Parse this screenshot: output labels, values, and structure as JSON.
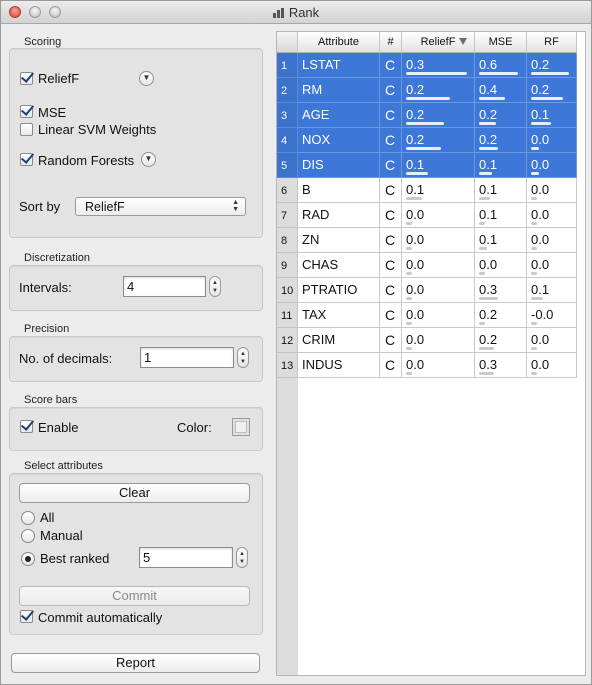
{
  "window": {
    "title": "Rank"
  },
  "scoring": {
    "group_label": "Scoring",
    "methods": [
      {
        "label": "ReliefF",
        "checked": true
      },
      {
        "label": "MSE",
        "checked": true
      },
      {
        "label": "Linear SVM Weights",
        "checked": false
      },
      {
        "label": "Random Forests",
        "checked": true
      }
    ],
    "sort_by_label": "Sort by",
    "sort_by_value": "ReliefF"
  },
  "discretization": {
    "group_label": "Discretization",
    "intervals_label": "Intervals:",
    "intervals_value": "4"
  },
  "precision": {
    "group_label": "Precision",
    "decimals_label": "No. of decimals:",
    "decimals_value": "1"
  },
  "score_bars": {
    "group_label": "Score bars",
    "enable_label": "Enable",
    "enable_checked": true,
    "color_label": "Color:"
  },
  "select_attributes": {
    "group_label": "Select attributes",
    "clear_label": "Clear",
    "options": [
      {
        "label": "All",
        "selected": false
      },
      {
        "label": "Manual",
        "selected": false
      },
      {
        "label": "Best ranked",
        "selected": true
      }
    ],
    "best_ranked_value": "5",
    "commit_label": "Commit",
    "commit_auto_label": "Commit automatically",
    "commit_auto_checked": true
  },
  "report_label": "Report",
  "table": {
    "columns": [
      "Attribute",
      "#",
      "ReliefF",
      "MSE",
      "RF"
    ],
    "sorted_column": "ReliefF",
    "rows": [
      {
        "num": "1",
        "attr": "LSTAT",
        "type": "C",
        "relieff": "0.3",
        "mse": "0.6",
        "rf": "0.2",
        "bars": [
          0.97,
          0.92,
          0.95
        ],
        "selected": true
      },
      {
        "num": "2",
        "attr": "RM",
        "type": "C",
        "relieff": "0.2",
        "mse": "0.4",
        "rf": "0.2",
        "bars": [
          0.7,
          0.62,
          0.8
        ],
        "selected": true
      },
      {
        "num": "3",
        "attr": "AGE",
        "type": "C",
        "relieff": "0.2",
        "mse": "0.2",
        "rf": "0.1",
        "bars": [
          0.6,
          0.4,
          0.5
        ],
        "selected": true
      },
      {
        "num": "4",
        "attr": "NOX",
        "type": "C",
        "relieff": "0.2",
        "mse": "0.2",
        "rf": "0.0",
        "bars": [
          0.55,
          0.45,
          0.2
        ],
        "selected": true
      },
      {
        "num": "5",
        "attr": "DIS",
        "type": "C",
        "relieff": "0.1",
        "mse": "0.1",
        "rf": "0.0",
        "bars": [
          0.35,
          0.3,
          0.2
        ],
        "selected": true
      },
      {
        "num": "6",
        "attr": "B",
        "type": "C",
        "relieff": "0.1",
        "mse": "0.1",
        "rf": "0.0",
        "bars": [
          0.25,
          0.25,
          0.0
        ],
        "selected": false
      },
      {
        "num": "7",
        "attr": "RAD",
        "type": "C",
        "relieff": "0.0",
        "mse": "0.1",
        "rf": "0.0",
        "bars": [
          0.0,
          0.0,
          0.0
        ],
        "selected": false
      },
      {
        "num": "8",
        "attr": "ZN",
        "type": "C",
        "relieff": "0.0",
        "mse": "0.1",
        "rf": "0.0",
        "bars": [
          0.0,
          0.2,
          0.0
        ],
        "selected": false
      },
      {
        "num": "9",
        "attr": "CHAS",
        "type": "C",
        "relieff": "0.0",
        "mse": "0.0",
        "rf": "0.0",
        "bars": [
          0.0,
          0.0,
          0.0
        ],
        "selected": false
      },
      {
        "num": "10",
        "attr": "PTRATIO",
        "type": "C",
        "relieff": "0.0",
        "mse": "0.3",
        "rf": "0.1",
        "bars": [
          0.1,
          0.45,
          0.3
        ],
        "selected": false
      },
      {
        "num": "11",
        "attr": "TAX",
        "type": "C",
        "relieff": "0.0",
        "mse": "0.2",
        "rf": "-0.0",
        "bars": [
          0.0,
          0.0,
          0.0
        ],
        "selected": false
      },
      {
        "num": "12",
        "attr": "CRIM",
        "type": "C",
        "relieff": "0.0",
        "mse": "0.2",
        "rf": "0.0",
        "bars": [
          0.0,
          0.35,
          0.0
        ],
        "selected": false
      },
      {
        "num": "13",
        "attr": "INDUS",
        "type": "C",
        "relieff": "0.0",
        "mse": "0.3",
        "rf": "0.0",
        "bars": [
          0.0,
          0.35,
          0.0
        ],
        "selected": false
      }
    ]
  }
}
